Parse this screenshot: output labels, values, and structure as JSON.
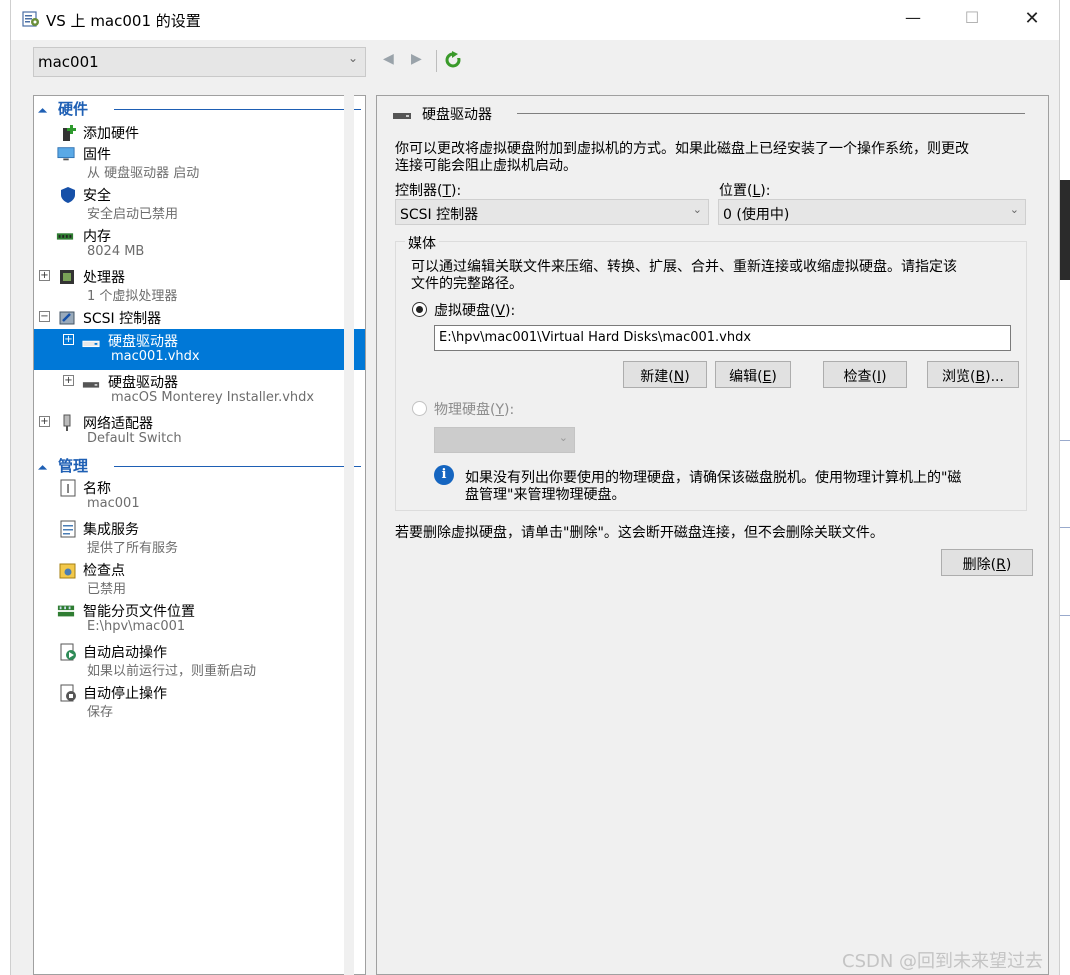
{
  "window": {
    "title": "VS 上 mac001 的设置"
  },
  "vm_selector": {
    "value": "mac001"
  },
  "hardware": {
    "header": "硬件",
    "items": [
      {
        "label": "添加硬件",
        "sub": ""
      },
      {
        "label": "固件",
        "sub": "从 硬盘驱动器 启动"
      },
      {
        "label": "安全",
        "sub": "安全启动已禁用"
      },
      {
        "label": "内存",
        "sub": "8024 MB"
      },
      {
        "label": "处理器",
        "sub": "1 个虚拟处理器"
      },
      {
        "label": "SCSI 控制器",
        "sub": ""
      },
      {
        "label": "硬盘驱动器",
        "sub": "mac001.vhdx"
      },
      {
        "label": "硬盘驱动器",
        "sub": "macOS Monterey Installer.vhdx"
      },
      {
        "label": "网络适配器",
        "sub": "Default Switch"
      }
    ]
  },
  "management": {
    "header": "管理",
    "items": [
      {
        "label": "名称",
        "sub": "mac001"
      },
      {
        "label": "集成服务",
        "sub": "提供了所有服务"
      },
      {
        "label": "检查点",
        "sub": "已禁用"
      },
      {
        "label": "智能分页文件位置",
        "sub": "E:\\hpv\\mac001"
      },
      {
        "label": "自动启动操作",
        "sub": "如果以前运行过，则重新启动"
      },
      {
        "label": "自动停止操作",
        "sub": "保存"
      }
    ]
  },
  "content": {
    "group_title": "硬盘驱动器",
    "intro_line1": "你可以更改将虚拟硬盘附加到虚拟机的方式。如果此磁盘上已经安装了一个操作系统，则更改",
    "intro_line2": "连接可能会阻止虚拟机启动。",
    "controller_label": "控制器",
    "controller_key": "T",
    "controller_value": "SCSI 控制器",
    "location_label": "位置",
    "location_key": "L",
    "location_value": "0 (使用中)",
    "media_title": "媒体",
    "media_line1": "可以通过编辑关联文件来压缩、转换、扩展、合并、重新连接或收缩虚拟硬盘。请指定该",
    "media_line2": "文件的完整路径。",
    "vhd_label": "虚拟硬盘",
    "vhd_key": "V",
    "vhd_path": "E:\\hpv\\mac001\\Virtual Hard Disks\\mac001.vhdx",
    "btn_new": "新建",
    "btn_new_key": "N",
    "btn_edit": "编辑",
    "btn_edit_key": "E",
    "btn_inspect": "检查",
    "btn_inspect_key": "I",
    "btn_browse": "浏览",
    "btn_browse_key": "B",
    "btn_browse_suffix": "...",
    "phys_label": "物理硬盘",
    "phys_key": "Y",
    "info_line1": "如果没有列出你要使用的物理硬盘，请确保该磁盘脱机。使用物理计算机上的\"磁",
    "info_line2": "盘管理\"来管理物理硬盘。",
    "remove_text": "若要删除虚拟硬盘，请单击\"删除\"。这会断开磁盘连接，但不会删除关联文件。",
    "btn_remove": "删除",
    "btn_remove_key": "R"
  },
  "watermark": "CSDN @回到未来望过去",
  "colors": {
    "selection": "#0078d7",
    "section_header": "#1e5fb4",
    "info": "#1565c0"
  }
}
